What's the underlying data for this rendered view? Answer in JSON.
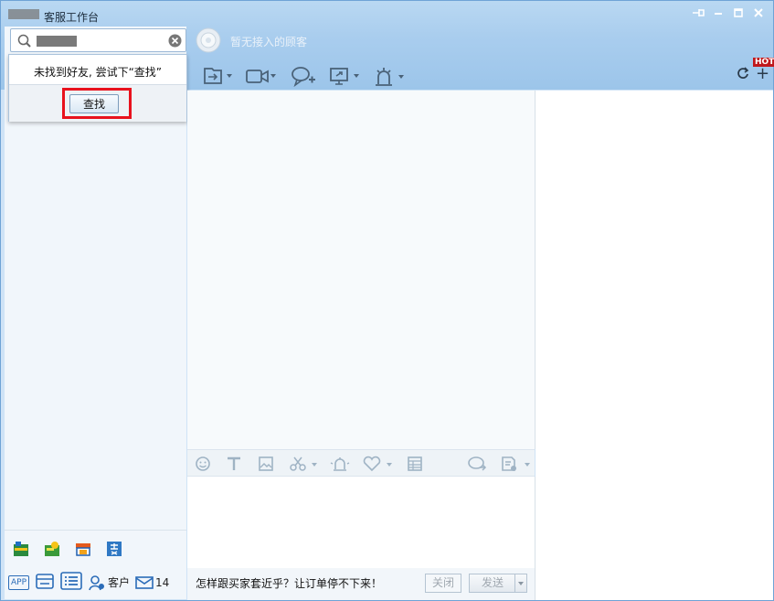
{
  "window": {
    "title": "客服工作台"
  },
  "search": {
    "placeholder": ""
  },
  "popup": {
    "message": "未找到好友, 尝试下“查找”",
    "find_button": "查找"
  },
  "header": {
    "visitor_status": "暂无接入的顾客"
  },
  "toolbar": {
    "icons": [
      "transfer-icon",
      "video-icon",
      "add-chat-icon",
      "screen-share-icon",
      "alert-icon"
    ],
    "hot_badge": "HOT",
    "plus_label": "+"
  },
  "editor_toolbar": {
    "icons": [
      "emoji-icon",
      "font-icon",
      "image-icon",
      "scissors-icon",
      "shake-icon",
      "heart-icon",
      "table-icon",
      "quick-reply-icon",
      "note-icon"
    ]
  },
  "footer": {
    "tip": "怎样跟买家套近乎？让订单停不下来！",
    "close_label": "关闭",
    "send_label": "发送"
  },
  "left_tools": {
    "app_label": "APP",
    "customer_label": "客户",
    "mail_count": "14"
  }
}
